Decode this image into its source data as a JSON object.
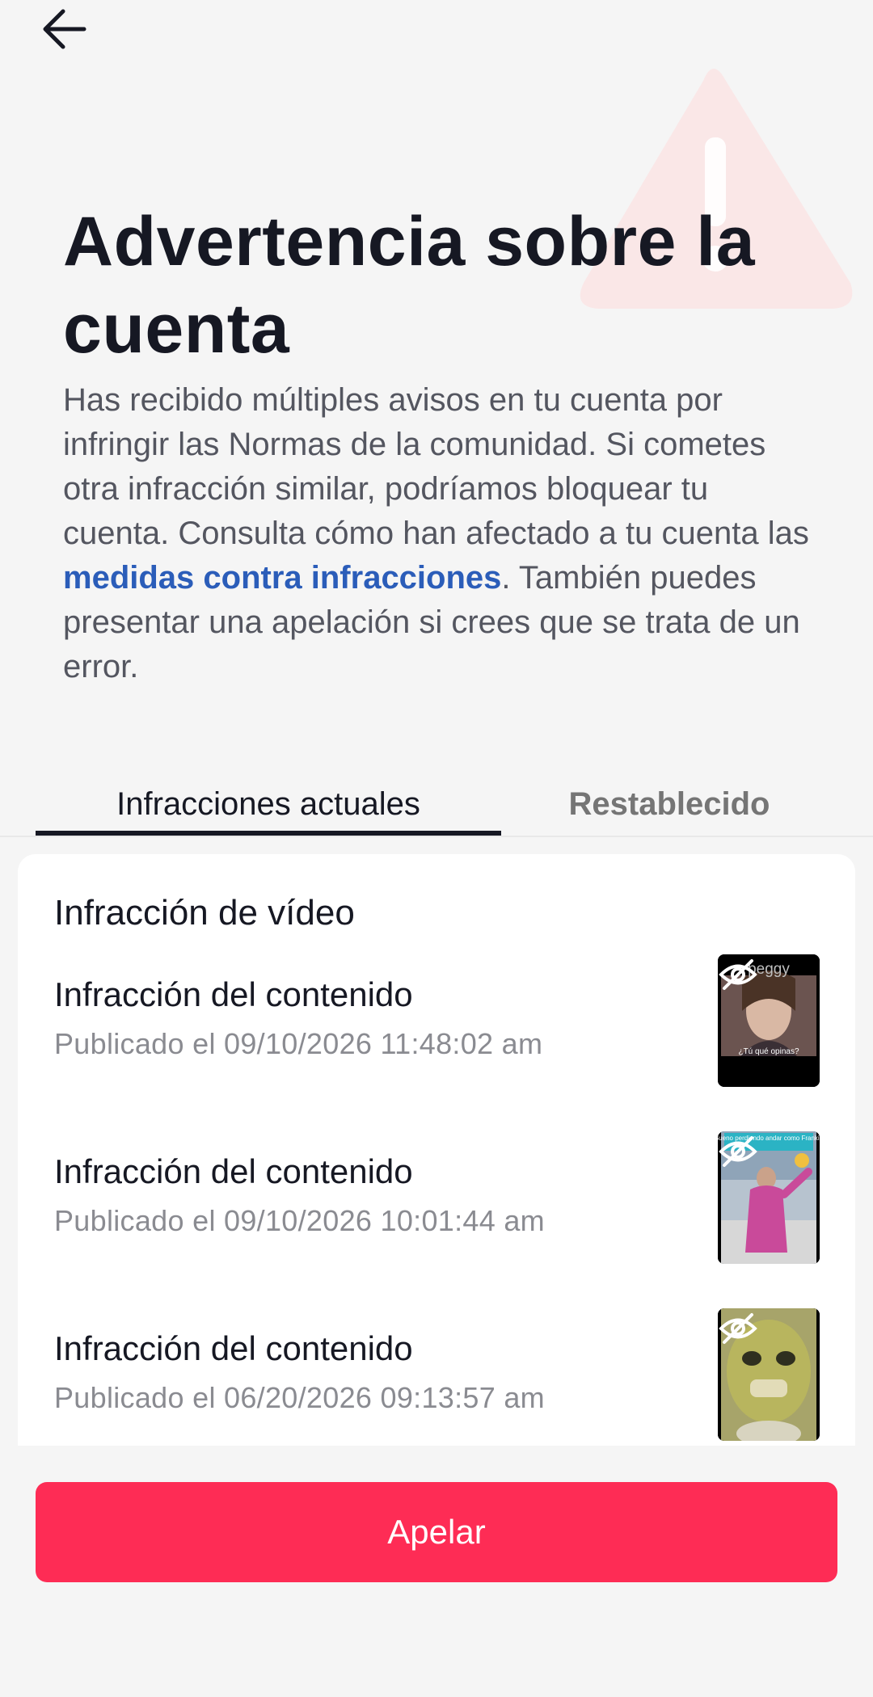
{
  "header": {
    "back_icon": "arrow-left-icon",
    "warning_icon": "warning-triangle-icon"
  },
  "page": {
    "title": "Advertencia sobre la cuenta",
    "description_part1": "Has recibido múltiples avisos en tu cuenta por infringir las Normas de la comunidad. Si cometes otra infracción similar, podríamos bloquear tu cuenta. Consulta cómo han afectado a tu cuenta las ",
    "description_link": "medidas contra infracciones",
    "description_part2": ". También puedes presentar una apelación si crees que se trata de un error."
  },
  "tabs": [
    {
      "label": "Infracciones actuales",
      "active": true
    },
    {
      "label": "Restablecido",
      "active": false
    }
  ],
  "card": {
    "title": "Infracción de vídeo",
    "items": [
      {
        "title": "Infracción del contenido",
        "published": "Publicado el 09/10/2026 11:48:02 am",
        "thumb_top_text": "peggy",
        "thumb_bottom_text": "¿Tú qué opinas?",
        "status_icon": "eye-off-icon"
      },
      {
        "title": "Infracción del contenido",
        "published": "Publicado el 09/10/2026 10:01:44 am",
        "thumb_top_text": "Bueno perdiendo andar como Frankie",
        "status_icon": "eye-off-icon"
      },
      {
        "title": "Infracción del contenido",
        "published": "Publicado el 06/20/2026 09:13:57 am",
        "status_icon": "eye-off-icon"
      }
    ]
  },
  "actions": {
    "appeal_label": "Apelar"
  },
  "colors": {
    "accent": "#fe2c55",
    "link": "#2b5db9",
    "text": "#161823",
    "muted": "#8a8b91"
  }
}
